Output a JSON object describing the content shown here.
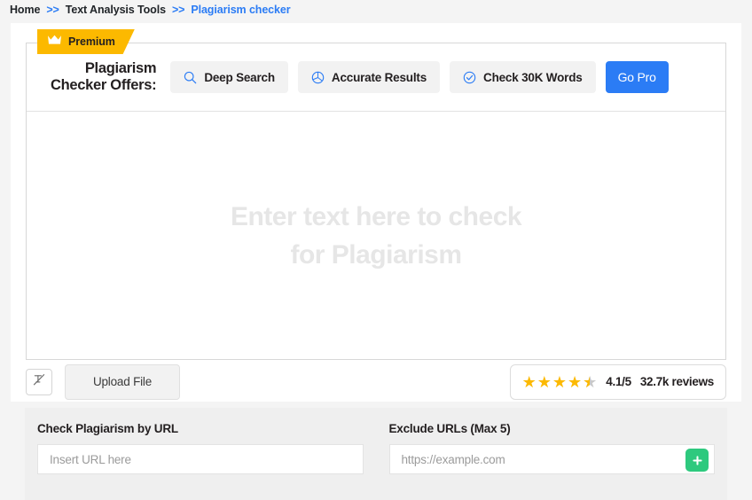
{
  "breadcrumb": {
    "items": [
      {
        "label": "Home",
        "current": false
      },
      {
        "label": "Text Analysis Tools",
        "current": false
      },
      {
        "label": "Plagiarism checker",
        "current": true
      }
    ],
    "separator": ">>"
  },
  "premium": {
    "label": "Premium",
    "icon": "crown-icon",
    "color": "#fcb900"
  },
  "offers": {
    "title": "Plagiarism\nChecker Offers:",
    "features": [
      {
        "label": "Deep Search",
        "icon": "magnifier-icon"
      },
      {
        "label": "Accurate Results",
        "icon": "pie-chart-icon"
      },
      {
        "label": "Check 30K Words",
        "icon": "check-circle-icon"
      }
    ],
    "cta": {
      "label": "Go Pro",
      "color": "#2b7cf5"
    }
  },
  "editor": {
    "placeholder": "Enter text here to check\nfor Plagiarism",
    "value": ""
  },
  "toolbar": {
    "format_icon": "text-format-icon",
    "upload_label": "Upload File"
  },
  "rating": {
    "stars_filled": 4,
    "stars_half": 1,
    "stars_total": 5,
    "score": "4.1/5",
    "reviews": "32.7k reviews",
    "star_color": "#fcb900"
  },
  "url_section": {
    "check_by_url": {
      "label": "Check Plagiarism by URL",
      "placeholder": "Insert URL here",
      "value": ""
    },
    "exclude_urls": {
      "label": "Exclude URLs (Max 5)",
      "placeholder": "https://example.com",
      "value": "",
      "add_button": {
        "icon": "plus-icon",
        "color": "#2ec97e"
      }
    }
  }
}
